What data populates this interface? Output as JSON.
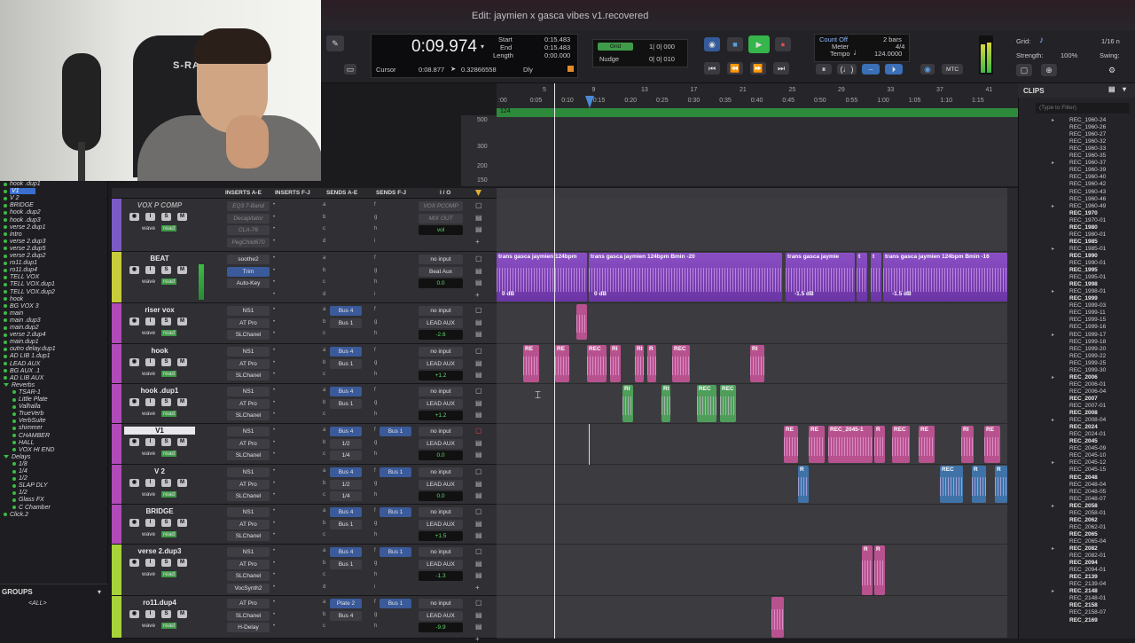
{
  "window": {
    "title": "Edit: jaymien x gasca vibes v1.recovered"
  },
  "counter": {
    "main": "0:09.974",
    "start_label": "Start",
    "end_label": "End",
    "length_label": "Length",
    "start": "0:15.483",
    "end": "0:15.483",
    "length": "0:00.000",
    "cursor_label": "Cursor",
    "cursor": "0:08.877",
    "sample_value": "0.32866558",
    "dly": "Dly"
  },
  "grid": {
    "label": "Grid",
    "value": "1| 0| 000",
    "nudge_label": "Nudge",
    "nudge": "0| 0| 010"
  },
  "count": {
    "countoff": "Count Off",
    "bars": "2 bars",
    "meter_label": "Meter",
    "meter": "4/4",
    "tempo_label": "Tempo",
    "tempo": "124.0000",
    "mtc": "MTC"
  },
  "gridpanel": {
    "grid_label": "Grid:",
    "grid_value": "1/16 n",
    "strength_label": "Strength:",
    "strength": "100%",
    "swing_label": "Swing:"
  },
  "ruler": {
    "top": [
      "5",
      "9",
      "13",
      "17",
      "21",
      "25",
      "29",
      "33",
      "37",
      "41"
    ],
    "bottom": [
      ":00",
      "0:05",
      "0:10",
      "0:15",
      "0:20",
      "0:25",
      "0:30",
      "0:35",
      "0:40",
      "0:45",
      "0:50",
      "0:55",
      "1:00",
      "1:05",
      "1:10",
      "1:15"
    ],
    "tempo_mark": "124",
    "vel_ticks": [
      "500",
      "300",
      "200",
      "150"
    ]
  },
  "left_nav": [
    "hook .dup1",
    "V1",
    "V 2",
    "BRIDGE",
    "hook .dup2",
    "hook .dup3",
    "verse 2.dup1",
    "intro",
    "verse 2.dup3",
    "verse 2.dup5",
    "verse 2.dup2",
    "ro11.dup1",
    "ro11.dup4",
    "TELL VOX",
    "TELL VOX.dup1",
    "TELL VOX.dup2",
    "hook",
    "BG VOX 3",
    "main",
    "main .dup3",
    "main.dup2",
    "verse 2.dup4",
    "main.dup1",
    "outro delay.dup1",
    "AD LIB 1.dup1",
    "LEAD AUX",
    "BG AUX .1",
    "AD LIB AUX",
    "Reverbs",
    "TSAR-1",
    "Little Plate",
    "Valhalla",
    "TrueVerb",
    "VerbSuite",
    "shimmer",
    "CHAMBER",
    "HALL",
    "VOX HI END",
    "Delays",
    "1/8",
    "1/4",
    "1/2",
    "SLAP DLY",
    "1/2",
    "Glass FX",
    "C Chamber",
    "Click.2"
  ],
  "groups": {
    "title": "GROUPS",
    "all": "<ALL>"
  },
  "mix_headers": [
    "INSERTS A-E",
    "INSERTS F-J",
    "SENDS A-E",
    "SENDS F-J",
    "I / O"
  ],
  "tracks": [
    {
      "name": "VOX P COMP",
      "ins": [
        "EQ3 7-Band",
        "Decapitator",
        "CLA-76",
        "PegChild670"
      ],
      "sends": [
        "",
        "",
        "",
        ""
      ],
      "sendsF": "",
      "io1": "VOX PCOMP",
      "io2": "MIX OUT",
      "vol": "vol",
      "pan": "< 100  100 >"
    },
    {
      "name": "BEAT",
      "ins": [
        "soothe2",
        "Trim",
        "Auto-Key"
      ],
      "sends": [
        "",
        "",
        "",
        ""
      ],
      "sendsF": "",
      "io1": "no input",
      "io2": "Beat Aux",
      "vol": "0.0",
      "pan": "< 100  100 >"
    },
    {
      "name": "riser vox",
      "ins": [
        "NS1",
        "AT Pro",
        "SLChanel"
      ],
      "sends": [
        "Bus 4",
        "Bus 1"
      ],
      "sendsF": "",
      "io1": "no input",
      "io2": "LEAD AUX",
      "vol": "-2.6",
      "pan": "0"
    },
    {
      "name": "hook",
      "ins": [
        "NS1",
        "AT Pro",
        "SLChanel"
      ],
      "sends": [
        "Bus 4",
        "Bus 1"
      ],
      "sendsF": "",
      "io1": "no input",
      "io2": "LEAD AUX",
      "vol": "+1.2",
      "pan": "0"
    },
    {
      "name": "hook .dup1",
      "ins": [
        "NS1",
        "AT Pro",
        "SLChanel"
      ],
      "sends": [
        "Bus 4",
        "Bus 1"
      ],
      "sendsF": "",
      "io1": "no input",
      "io2": "LEAD AUX",
      "vol": "+1.2",
      "pan": "0"
    },
    {
      "name": "V1",
      "ins": [
        "NS1",
        "AT Pro",
        "SLChanel"
      ],
      "sends": [
        "Bus 4",
        "1/2",
        "1/4"
      ],
      "sendsF": "Bus 1",
      "io1": "no input",
      "io2": "LEAD AUX",
      "vol": "0.0",
      "pan": "0"
    },
    {
      "name": "V 2",
      "ins": [
        "NS1",
        "AT Pro",
        "SLChanel"
      ],
      "sends": [
        "Bus 4",
        "1/2",
        "1/4"
      ],
      "sendsF": "Bus 1",
      "io1": "no input",
      "io2": "LEAD AUX",
      "vol": "0.0",
      "pan": "0"
    },
    {
      "name": "BRIDGE",
      "ins": [
        "NS1",
        "AT Pro",
        "SLChanel"
      ],
      "sends": [
        "Bus 4",
        "Bus 1"
      ],
      "sendsF": "Bus 1",
      "io1": "no input",
      "io2": "LEAD AUX",
      "vol": "+1.5",
      "pan": "0"
    },
    {
      "name": "verse 2.dup3",
      "ins": [
        "NS1",
        "AT Pro",
        "SLChanel",
        "VocSynth2"
      ],
      "sends": [
        "Bus 4",
        "Bus 1"
      ],
      "sendsF": "Bus 1",
      "io1": "no input",
      "io2": "LEAD AUX",
      "vol": "-1.3",
      "pan": "0"
    },
    {
      "name": "ro11.dup4",
      "ins": [
        "AT Pro",
        "SLChanel",
        "H-Delay"
      ],
      "sends": [
        "Plate 2",
        "Bus 4"
      ],
      "sendsF": "Bus 1",
      "io1": "no input",
      "io2": "LEAD AUX",
      "vol": "-9.9",
      "pan": ""
    }
  ],
  "clips_lane": {
    "beat": [
      "trans gasca jaymien 124bpm",
      "trans gasca jaymien 124bpm Bmin -20",
      "trans gasca jaymie",
      "t",
      "t",
      "trans gasca jaymien 124bpm Bmin -16"
    ],
    "beat_gain": [
      "0 dB",
      "0 dB",
      "-1.5 dB",
      "-1.5 dB"
    ],
    "hook": [
      "RE",
      "RE",
      "REC",
      "RI",
      "RI",
      "R",
      "REC",
      "RI"
    ],
    "hook_dup": [
      "RI",
      "RI",
      "REC",
      "REC"
    ],
    "v1": [
      "RE",
      "RE",
      "REC_2045-1",
      "R",
      "REC",
      "RE",
      "RI",
      "RE"
    ],
    "v2": [
      "R",
      "REC",
      "R",
      "R"
    ],
    "verse": [
      "R",
      "R"
    ]
  },
  "clip_list": {
    "title": "CLIPS",
    "filter": "(Type to Filter)",
    "items": [
      "REC_1960-24",
      "REC_1960-26",
      "REC_1960-27",
      "REC_1960-32",
      "REC_1960-33",
      "REC_1960-35",
      "REC_1960-37",
      "REC_1960-39",
      "REC_1960-40",
      "REC_1960-42",
      "REC_1960-43",
      "REC_1960-46",
      "REC_1960-49",
      "REC_1970",
      "REC_1970-01",
      "REC_1980",
      "REC_1980-01",
      "REC_1985",
      "REC_1985-01",
      "REC_1990",
      "REC_1990-01",
      "REC_1995",
      "REC_1995-01",
      "REC_1998",
      "REC_1998-01",
      "REC_1999",
      "REC_1999-03",
      "REC_1999-11",
      "REC_1999-15",
      "REC_1999-16",
      "REC_1999-17",
      "REC_1999-18",
      "REC_1999-20",
      "REC_1999-22",
      "REC_1999-25",
      "REC_1999-30",
      "REC_2006",
      "REC_2006-01",
      "REC_2006-04",
      "REC_2007",
      "REC_2007-01",
      "REC_2008",
      "REC_2008-04",
      "REC_2024",
      "REC_2024-01",
      "REC_2045",
      "REC_2045-09",
      "REC_2045-10",
      "REC_2045-12",
      "REC_2045-15",
      "REC_2048",
      "REC_2048-04",
      "REC_2048-05",
      "REC_2048-07",
      "REC_2058",
      "REC_2058-01",
      "REC_2062",
      "REC_2062-01",
      "REC_2065",
      "REC_2065-04",
      "REC_2082",
      "REC_2082-01",
      "REC_2094",
      "REC_2094-01",
      "REC_2139",
      "REC_2139-04",
      "REC_2148",
      "REC_2148-01",
      "REC_2158",
      "REC_2158-07",
      "REC_2169"
    ]
  }
}
